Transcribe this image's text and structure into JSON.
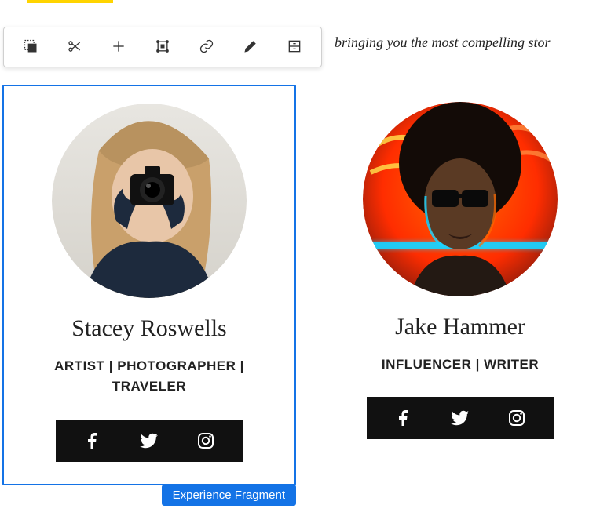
{
  "tab_indicator": true,
  "toolbar": {
    "parent_label": "Parent",
    "cut_label": "Cut",
    "add_label": "Insert component",
    "layout_label": "Layout",
    "link_label": "Link",
    "edit_label": "Edit",
    "template_label": "Configure"
  },
  "intro_text": " bringing you the most compelling stor",
  "selection_label": "Experience Fragment",
  "people": [
    {
      "name": "Stacey Roswells",
      "role": "ARTIST | PHOTOGRAPHER | TRAVELER",
      "selected": true,
      "social": [
        "facebook",
        "twitter",
        "instagram"
      ]
    },
    {
      "name": "Jake Hammer",
      "role": "INFLUENCER | WRITER",
      "selected": false,
      "social": [
        "facebook",
        "twitter",
        "instagram"
      ]
    }
  ]
}
